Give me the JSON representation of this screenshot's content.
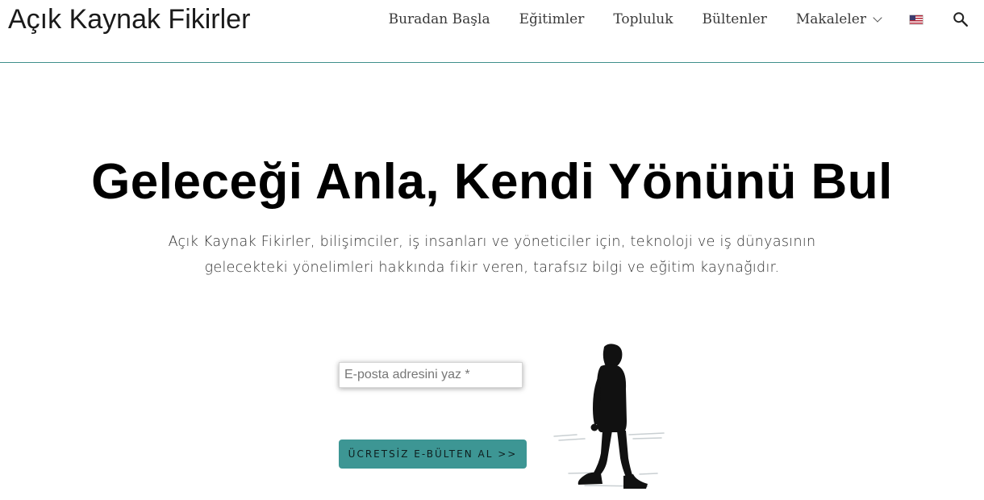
{
  "header": {
    "site_title": "Açık Kaynak Fikirler",
    "nav": {
      "start": "Buradan Başla",
      "courses": "Eğitimler",
      "community": "Topluluk",
      "newsletters": "Bültenler",
      "articles": "Makaleler"
    },
    "language_icon": "us-flag-icon",
    "search_icon": "search-icon"
  },
  "hero": {
    "title": "Geleceği Anla, Kendi Yönünü Bul",
    "subtitle_line1": "Açık Kaynak Fikirler, bilişimciler, iş insanları ve yöneticiler için, teknoloji ve iş dünyasının",
    "subtitle_line2": "gelecekteki yönelimleri hakkında fikir veren, tarafsız bilgi ve eğitim kaynağıdır."
  },
  "signup": {
    "email_placeholder": "E-posta adresini yaz *",
    "email_value": "",
    "button_label": "ÜCRETSİZ E-BÜLTEN AL >>"
  },
  "colors": {
    "accent": "#3d9694",
    "header_border": "#3f8f8b"
  }
}
